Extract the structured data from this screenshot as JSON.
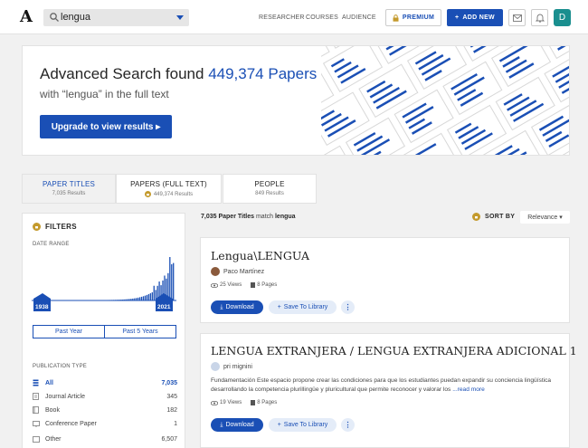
{
  "header": {
    "logo": "A",
    "search_value": "lengua",
    "nav": [
      "RESEARCHER",
      "COURSES",
      "AUDIENCE"
    ],
    "premium_label": "PREMIUM",
    "add_new_label": "ADD NEW",
    "avatar_letter": "D",
    "accent": "#1a4fb5"
  },
  "banner": {
    "title_prefix": "Advanced Search found ",
    "title_count": "449,374 Papers",
    "subtitle": "with “lengua” in the full text",
    "cta": "Upgrade to view results ▸"
  },
  "tabs": [
    {
      "title": "PAPER TITLES",
      "count": "7,035 Results"
    },
    {
      "title": "PAPERS (FULL TEXT)",
      "count": "449,374 Results"
    },
    {
      "title": "PEOPLE",
      "count": "849 Results"
    }
  ],
  "filters": {
    "header": "FILTERS",
    "date_range_label": "DATE RANGE",
    "year_start": "1938",
    "year_end": "2021",
    "past_year": "Past Year",
    "past_5_years": "Past 5 Years",
    "publication_type_label": "PUBLICATION TYPE",
    "types": [
      {
        "label": "All",
        "count": "7,035"
      },
      {
        "label": "Journal Article",
        "count": "345"
      },
      {
        "label": "Book",
        "count": "182"
      },
      {
        "label": "Conference Paper",
        "count": "1"
      },
      {
        "label": "Other",
        "count": "6,507"
      }
    ]
  },
  "results": {
    "count": "7,035 Paper Titles",
    "match_text": " match ",
    "query": "lengua",
    "sort_label": "SORT BY",
    "sort_value": "Relevance ▾"
  },
  "cards": [
    {
      "title": "Lengua\\LENGUA",
      "author": "Paco Martínez",
      "views": "25 Views",
      "pages": "8 Pages",
      "download": "Download",
      "save": "Save To Library",
      "more": "⋮"
    },
    {
      "title": "LENGUA EXTRANJERA / LENGUA EXTRANJERA ADICIONAL 1",
      "author": "pri mignini",
      "abstract": "Fundamentación Este espacio propone crear las condiciones para que los estudiantes puedan expandir su conciencia lingüística desarrollando la competencia plurillingüe y pluricultural que permite reconocer y valorar los ",
      "read_more": "...read more",
      "views": "19 Views",
      "pages": "8 Pages",
      "download": "Download",
      "save": "Save To Library",
      "more": "⋮"
    }
  ]
}
